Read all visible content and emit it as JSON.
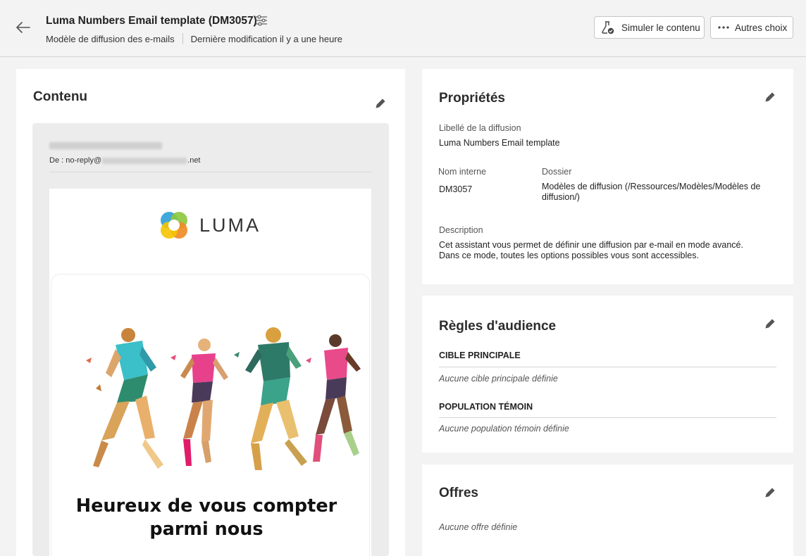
{
  "header": {
    "title": "Luma Numbers Email template (DM3057)",
    "template_type": "Modèle de diffusion des e-mails",
    "last_modified": "Dernière modification il y a une heure",
    "simulate_label": "Simuler le contenu",
    "more_label": "Autres choix"
  },
  "content": {
    "title": "Contenu",
    "email": {
      "from_prefix": "De : no-reply@",
      "from_suffix": ".net",
      "logo_text": "LUMA",
      "hero_text": "Heureux de vous compter parmi nous"
    }
  },
  "properties": {
    "title": "Propriétés",
    "label_caption": "Libellé de la diffusion",
    "label_value": "Luma Numbers Email template",
    "internal_name_caption": "Nom interne",
    "internal_name_value": "DM3057",
    "folder_caption": "Dossier",
    "folder_value": "Modèles de diffusion (/Ressources/Modèles/Modèles de diffusion/)",
    "description_caption": "Description",
    "description_value": "Cet assistant vous permet de définir une diffusion par e-mail en mode avancé. Dans ce mode, toutes les options possibles vous sont accessibles."
  },
  "audience": {
    "title": "Règles d'audience",
    "main_target_heading": "CIBLE PRINCIPALE",
    "main_target_empty": "Aucune cible principale définie",
    "control_group_heading": "POPULATION TÉMOIN",
    "control_group_empty": "Aucune population témoin définie"
  },
  "offers": {
    "title": "Offres",
    "empty": "Aucune offre définie"
  },
  "colors": {
    "background": "#f3f3f3",
    "card": "#ffffff",
    "logo_green": "#8cc63f",
    "logo_blue": "#2a9fd8",
    "logo_orange": "#f08a24",
    "logo_yellow": "#f5c400"
  },
  "icons": [
    "back-arrow-icon",
    "settings-sliders-icon",
    "flask-check-icon",
    "more-dots-icon",
    "pencil-icon"
  ]
}
